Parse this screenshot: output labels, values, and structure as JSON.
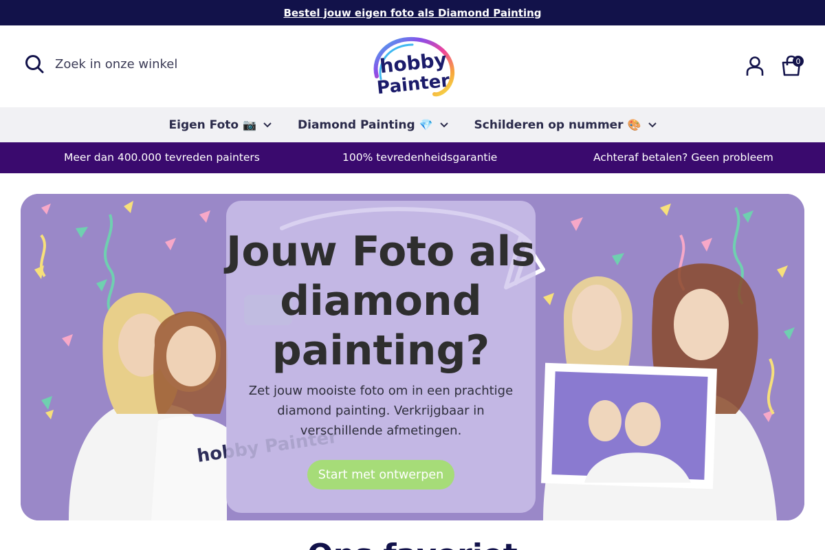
{
  "announcement": {
    "link_text": "Bestel jouw eigen foto als Diamond Painting"
  },
  "header": {
    "search_placeholder": "Zoek in onze winkel",
    "logo_text_top": "hobby",
    "logo_text_bottom": "Painter",
    "cart_count": "0"
  },
  "nav": {
    "items": [
      {
        "label": "Eigen Foto",
        "emoji": "📷"
      },
      {
        "label": "Diamond Painting",
        "emoji": "💎"
      },
      {
        "label": "Schilderen op nummer",
        "emoji": "🎨"
      }
    ]
  },
  "usp": {
    "items": [
      "Meer dan 400.000 tevreden painters",
      "100% tevredenheidsgarantie",
      "Achteraf betalen? Geen probleem"
    ]
  },
  "hero": {
    "title_line1": "Jouw Foto als",
    "title_line2": "diamond",
    "title_line3": "painting?",
    "text": "Zet jouw mooiste foto om in een prachtige diamond painting. Verkrijgbaar in verschillende afmetingen.",
    "button_label": "Start met ontwerpen",
    "shirt_logo_text": "hobby Painter"
  },
  "colors": {
    "announcement_bg": "#12124a",
    "usp_bg": "#3a0a6e",
    "hero_bg": "#9a88c8",
    "cta_green": "#a6dc78"
  },
  "section": {
    "title_partial": "Ons favoriet"
  }
}
